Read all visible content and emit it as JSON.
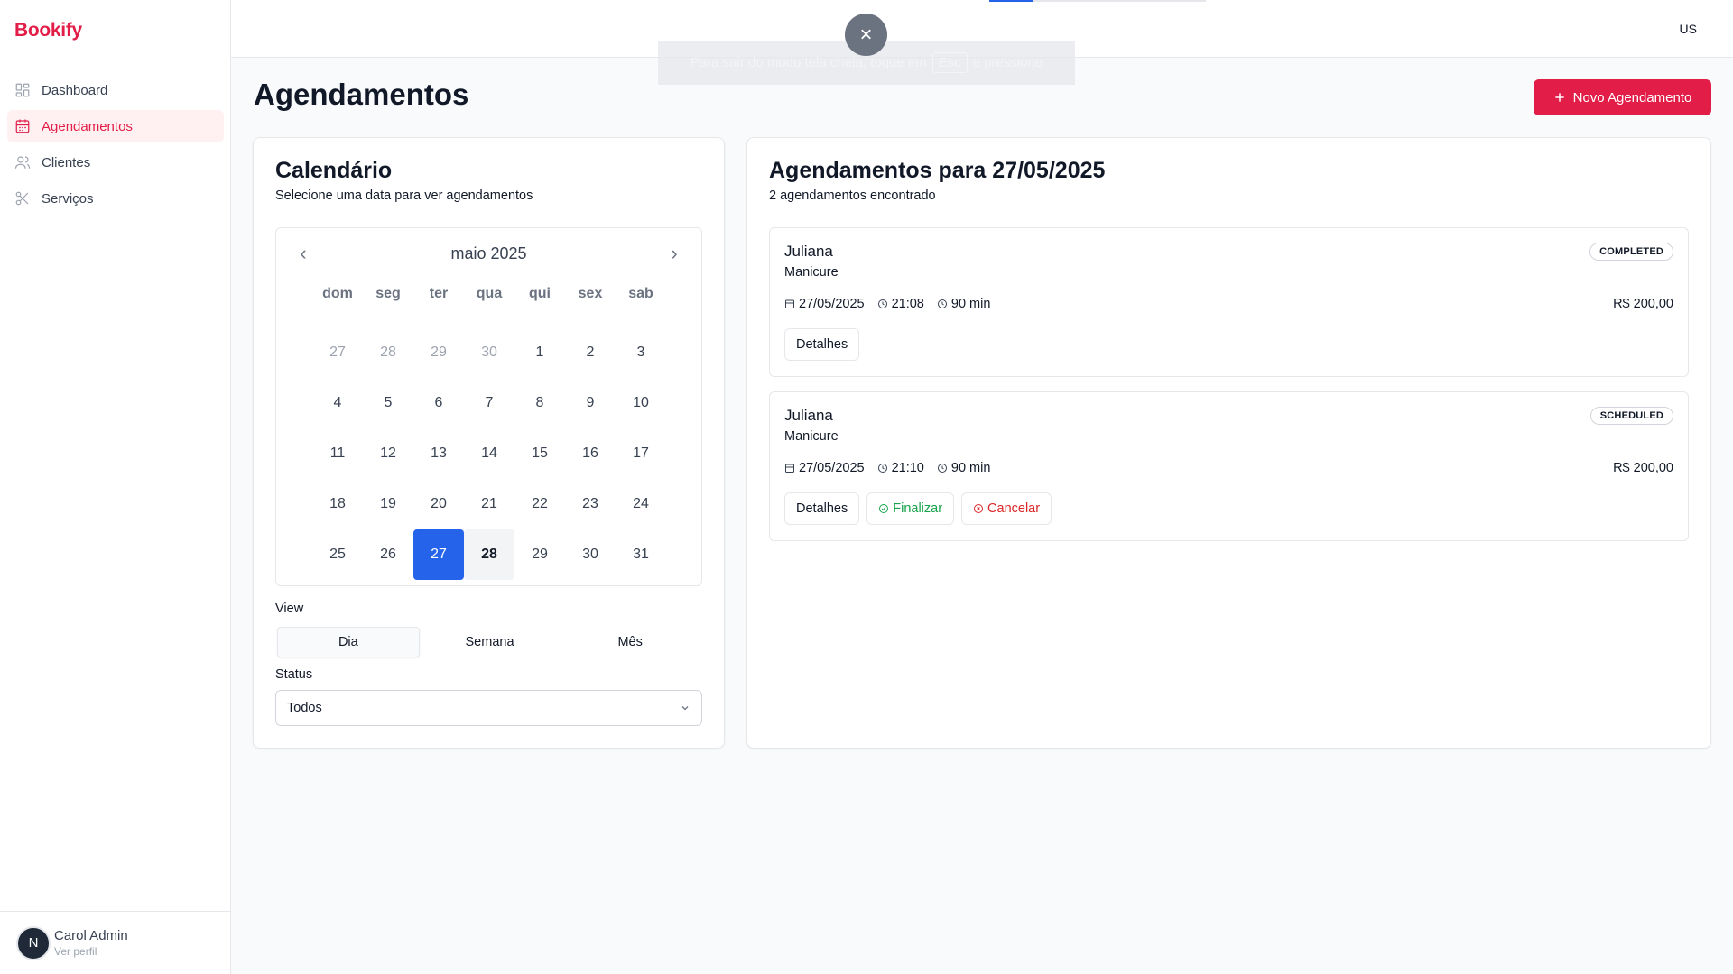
{
  "app": {
    "name": "Bookify",
    "lang": "US"
  },
  "fullscreen": {
    "close_label": "×",
    "msg_before": "Para sair do modo tela cheia, toque em",
    "key": "Esc",
    "msg_after": "e pressione"
  },
  "sidebar": {
    "items": [
      {
        "label": "Dashboard",
        "icon": "dashboard-icon"
      },
      {
        "label": "Agendamentos",
        "icon": "calendar-icon",
        "active": true
      },
      {
        "label": "Clientes",
        "icon": "users-icon"
      },
      {
        "label": "Serviços",
        "icon": "scissors-icon"
      }
    ],
    "user": {
      "initial": "N",
      "name": "Carol Admin",
      "link": "Ver perfil"
    }
  },
  "page": {
    "title": "Agendamentos",
    "new_button": "Novo Agendamento"
  },
  "calendar_card": {
    "title": "Calendário",
    "subtitle": "Selecione uma data para ver agendamentos",
    "month": "maio 2025",
    "weekdays": [
      "dom",
      "seg",
      "ter",
      "qua",
      "qui",
      "sex",
      "sab"
    ],
    "days": [
      {
        "d": "27",
        "muted": true
      },
      {
        "d": "28",
        "muted": true
      },
      {
        "d": "29",
        "muted": true
      },
      {
        "d": "30",
        "muted": true
      },
      {
        "d": "1"
      },
      {
        "d": "2"
      },
      {
        "d": "3"
      },
      {
        "d": "4"
      },
      {
        "d": "5"
      },
      {
        "d": "6"
      },
      {
        "d": "7"
      },
      {
        "d": "8"
      },
      {
        "d": "9"
      },
      {
        "d": "10"
      },
      {
        "d": "11"
      },
      {
        "d": "12"
      },
      {
        "d": "13"
      },
      {
        "d": "14"
      },
      {
        "d": "15"
      },
      {
        "d": "16"
      },
      {
        "d": "17"
      },
      {
        "d": "18"
      },
      {
        "d": "19"
      },
      {
        "d": "20"
      },
      {
        "d": "21"
      },
      {
        "d": "22"
      },
      {
        "d": "23"
      },
      {
        "d": "24"
      },
      {
        "d": "25"
      },
      {
        "d": "26"
      },
      {
        "d": "27",
        "selected": true
      },
      {
        "d": "28",
        "today": true
      },
      {
        "d": "29"
      },
      {
        "d": "30"
      },
      {
        "d": "31"
      }
    ],
    "view_label": "View",
    "views": [
      "Dia",
      "Semana",
      "Mês"
    ],
    "active_view": "Dia",
    "status_label": "Status",
    "status_value": "Todos"
  },
  "appointments_card": {
    "title": "Agendamentos para 27/05/2025",
    "subtitle": "2 agendamentos encontrado",
    "items": [
      {
        "client": "Juliana",
        "service": "Manicure",
        "status": "COMPLETED",
        "date": "27/05/2025",
        "time": "21:08",
        "duration": "90 min",
        "price": "R$ 200,00",
        "actions": [
          "Detalhes"
        ]
      },
      {
        "client": "Juliana",
        "service": "Manicure",
        "status": "SCHEDULED",
        "date": "27/05/2025",
        "time": "21:10",
        "duration": "90 min",
        "price": "R$ 200,00",
        "actions": [
          "Detalhes",
          "Finalizar",
          "Cancelar"
        ]
      }
    ]
  },
  "colors": {
    "brand": "#e11d48",
    "selected_day": "#2563eb",
    "finalize": "#16a34a",
    "cancel": "#dc2626"
  }
}
